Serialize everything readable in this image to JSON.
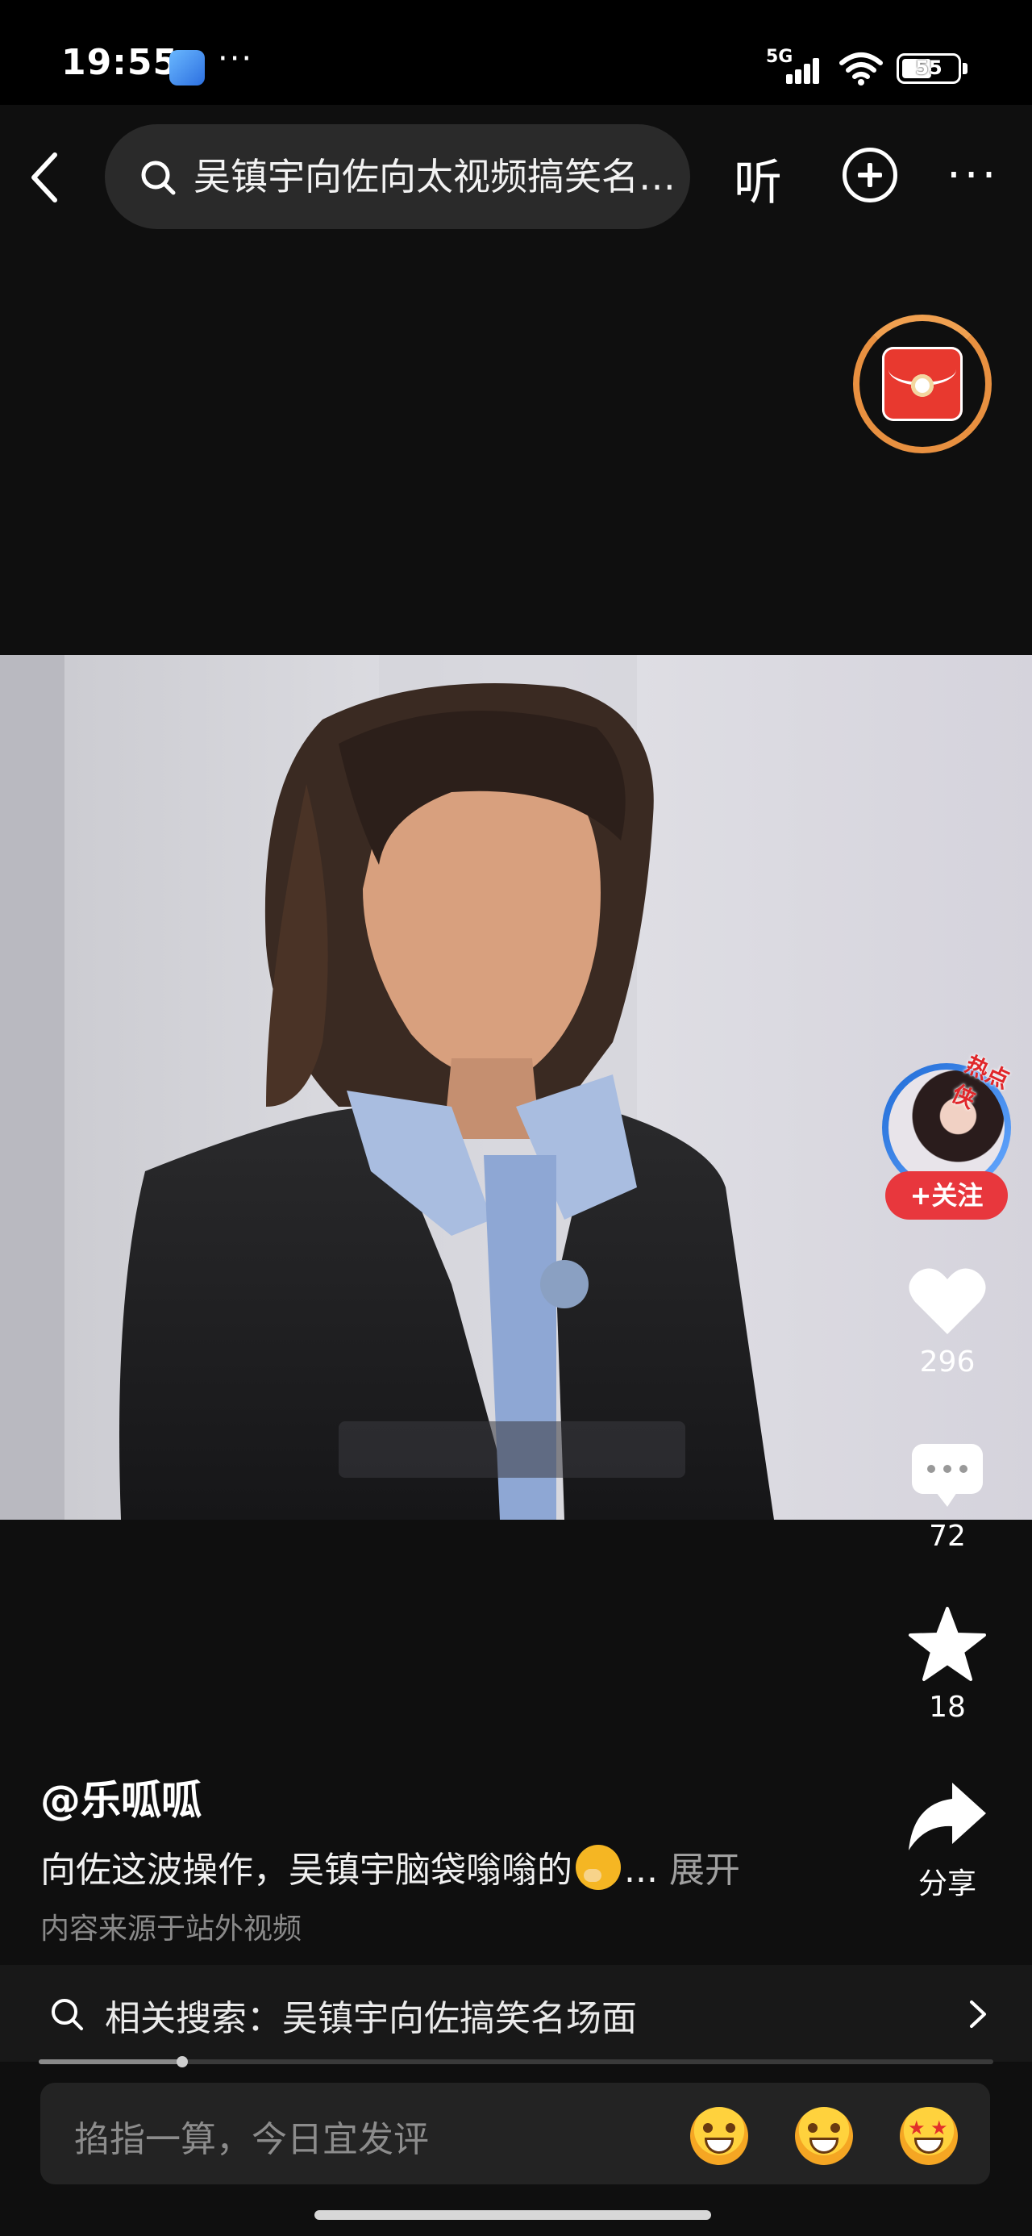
{
  "status_bar": {
    "time": "19:55",
    "more_indicator": "···",
    "network": "5G",
    "battery": "55"
  },
  "header": {
    "search_query": "吴镇宇向佐向太视频搞笑名场面",
    "listen_label": "听",
    "more_label": "···"
  },
  "actions": {
    "follow_label": "+关注",
    "hot_badge": "热点侠",
    "likes": "296",
    "comments": "72",
    "favorites": "18",
    "share_label": "分享"
  },
  "post": {
    "author": "@乐呱呱",
    "caption": "向佐这波操作，吴镇宇脑袋嗡嗡的",
    "caption_ellipsis": "...",
    "expand_label": "展开",
    "source_note": "内容来源于站外视频"
  },
  "related_search": {
    "text": "相关搜索：吴镇宇向佐搞笑名场面"
  },
  "video": {
    "progress": 0.15
  },
  "comment_box": {
    "placeholder": "掐指一算，今日宜发评"
  },
  "colors": {
    "background": "#0f0f0f",
    "accent_red": "#e8373d",
    "ring_orange": "#e89040"
  }
}
